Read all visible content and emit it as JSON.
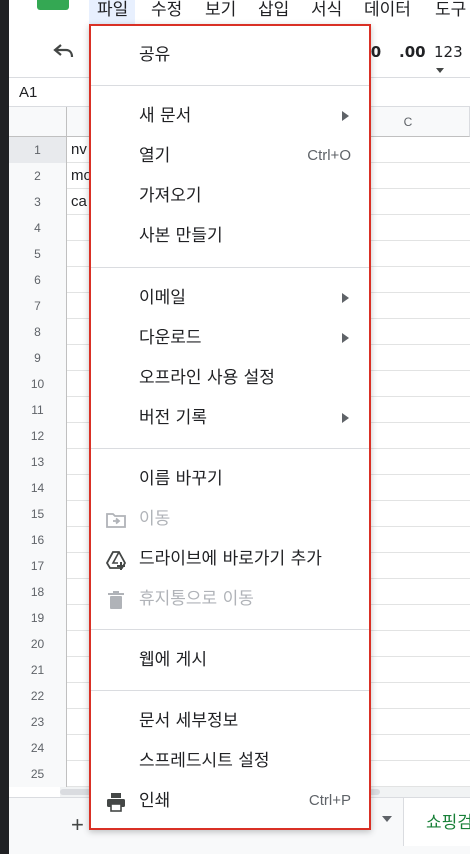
{
  "menubar": {
    "items": [
      "파일",
      "수정",
      "보기",
      "삽입",
      "서식",
      "데이터",
      "도구"
    ]
  },
  "toolbar": {
    "undo_icon": "undo-icon",
    "decimal_decrease": ".0",
    "decimal_increase": ".00",
    "number_format": "123"
  },
  "formula_bar": {
    "name_box": "A1"
  },
  "grid": {
    "column_c": "C",
    "rows": [
      "1",
      "2",
      "3",
      "4",
      "5",
      "6",
      "7",
      "8",
      "9",
      "10",
      "11",
      "12",
      "13",
      "14",
      "15",
      "16",
      "17",
      "18",
      "19",
      "20",
      "21",
      "22",
      "23",
      "24",
      "25"
    ],
    "cells_a": [
      "nv",
      "mo",
      "ca"
    ]
  },
  "sheetbar": {
    "add_label": "+",
    "tab_label": "쇼핑검"
  },
  "file_menu": {
    "share": "공유",
    "new": "새 문서",
    "open": "열기",
    "open_shortcut": "Ctrl+O",
    "import": "가져오기",
    "copy": "사본 만들기",
    "email": "이메일",
    "download": "다운로드",
    "offline": "오프라인 사용 설정",
    "version_history": "버전 기록",
    "rename": "이름 바꾸기",
    "move": "이동",
    "add_shortcut": "드라이브에 바로가기 추가",
    "trash": "휴지통으로 이동",
    "publish": "웹에 게시",
    "details": "문서 세부정보",
    "settings": "스프레드시트 설정",
    "print": "인쇄",
    "print_shortcut": "Ctrl+P"
  },
  "colors": {
    "menu_border": "#d93025",
    "sheets_green": "#34a853",
    "active_menubar": "#e8f0fe"
  }
}
